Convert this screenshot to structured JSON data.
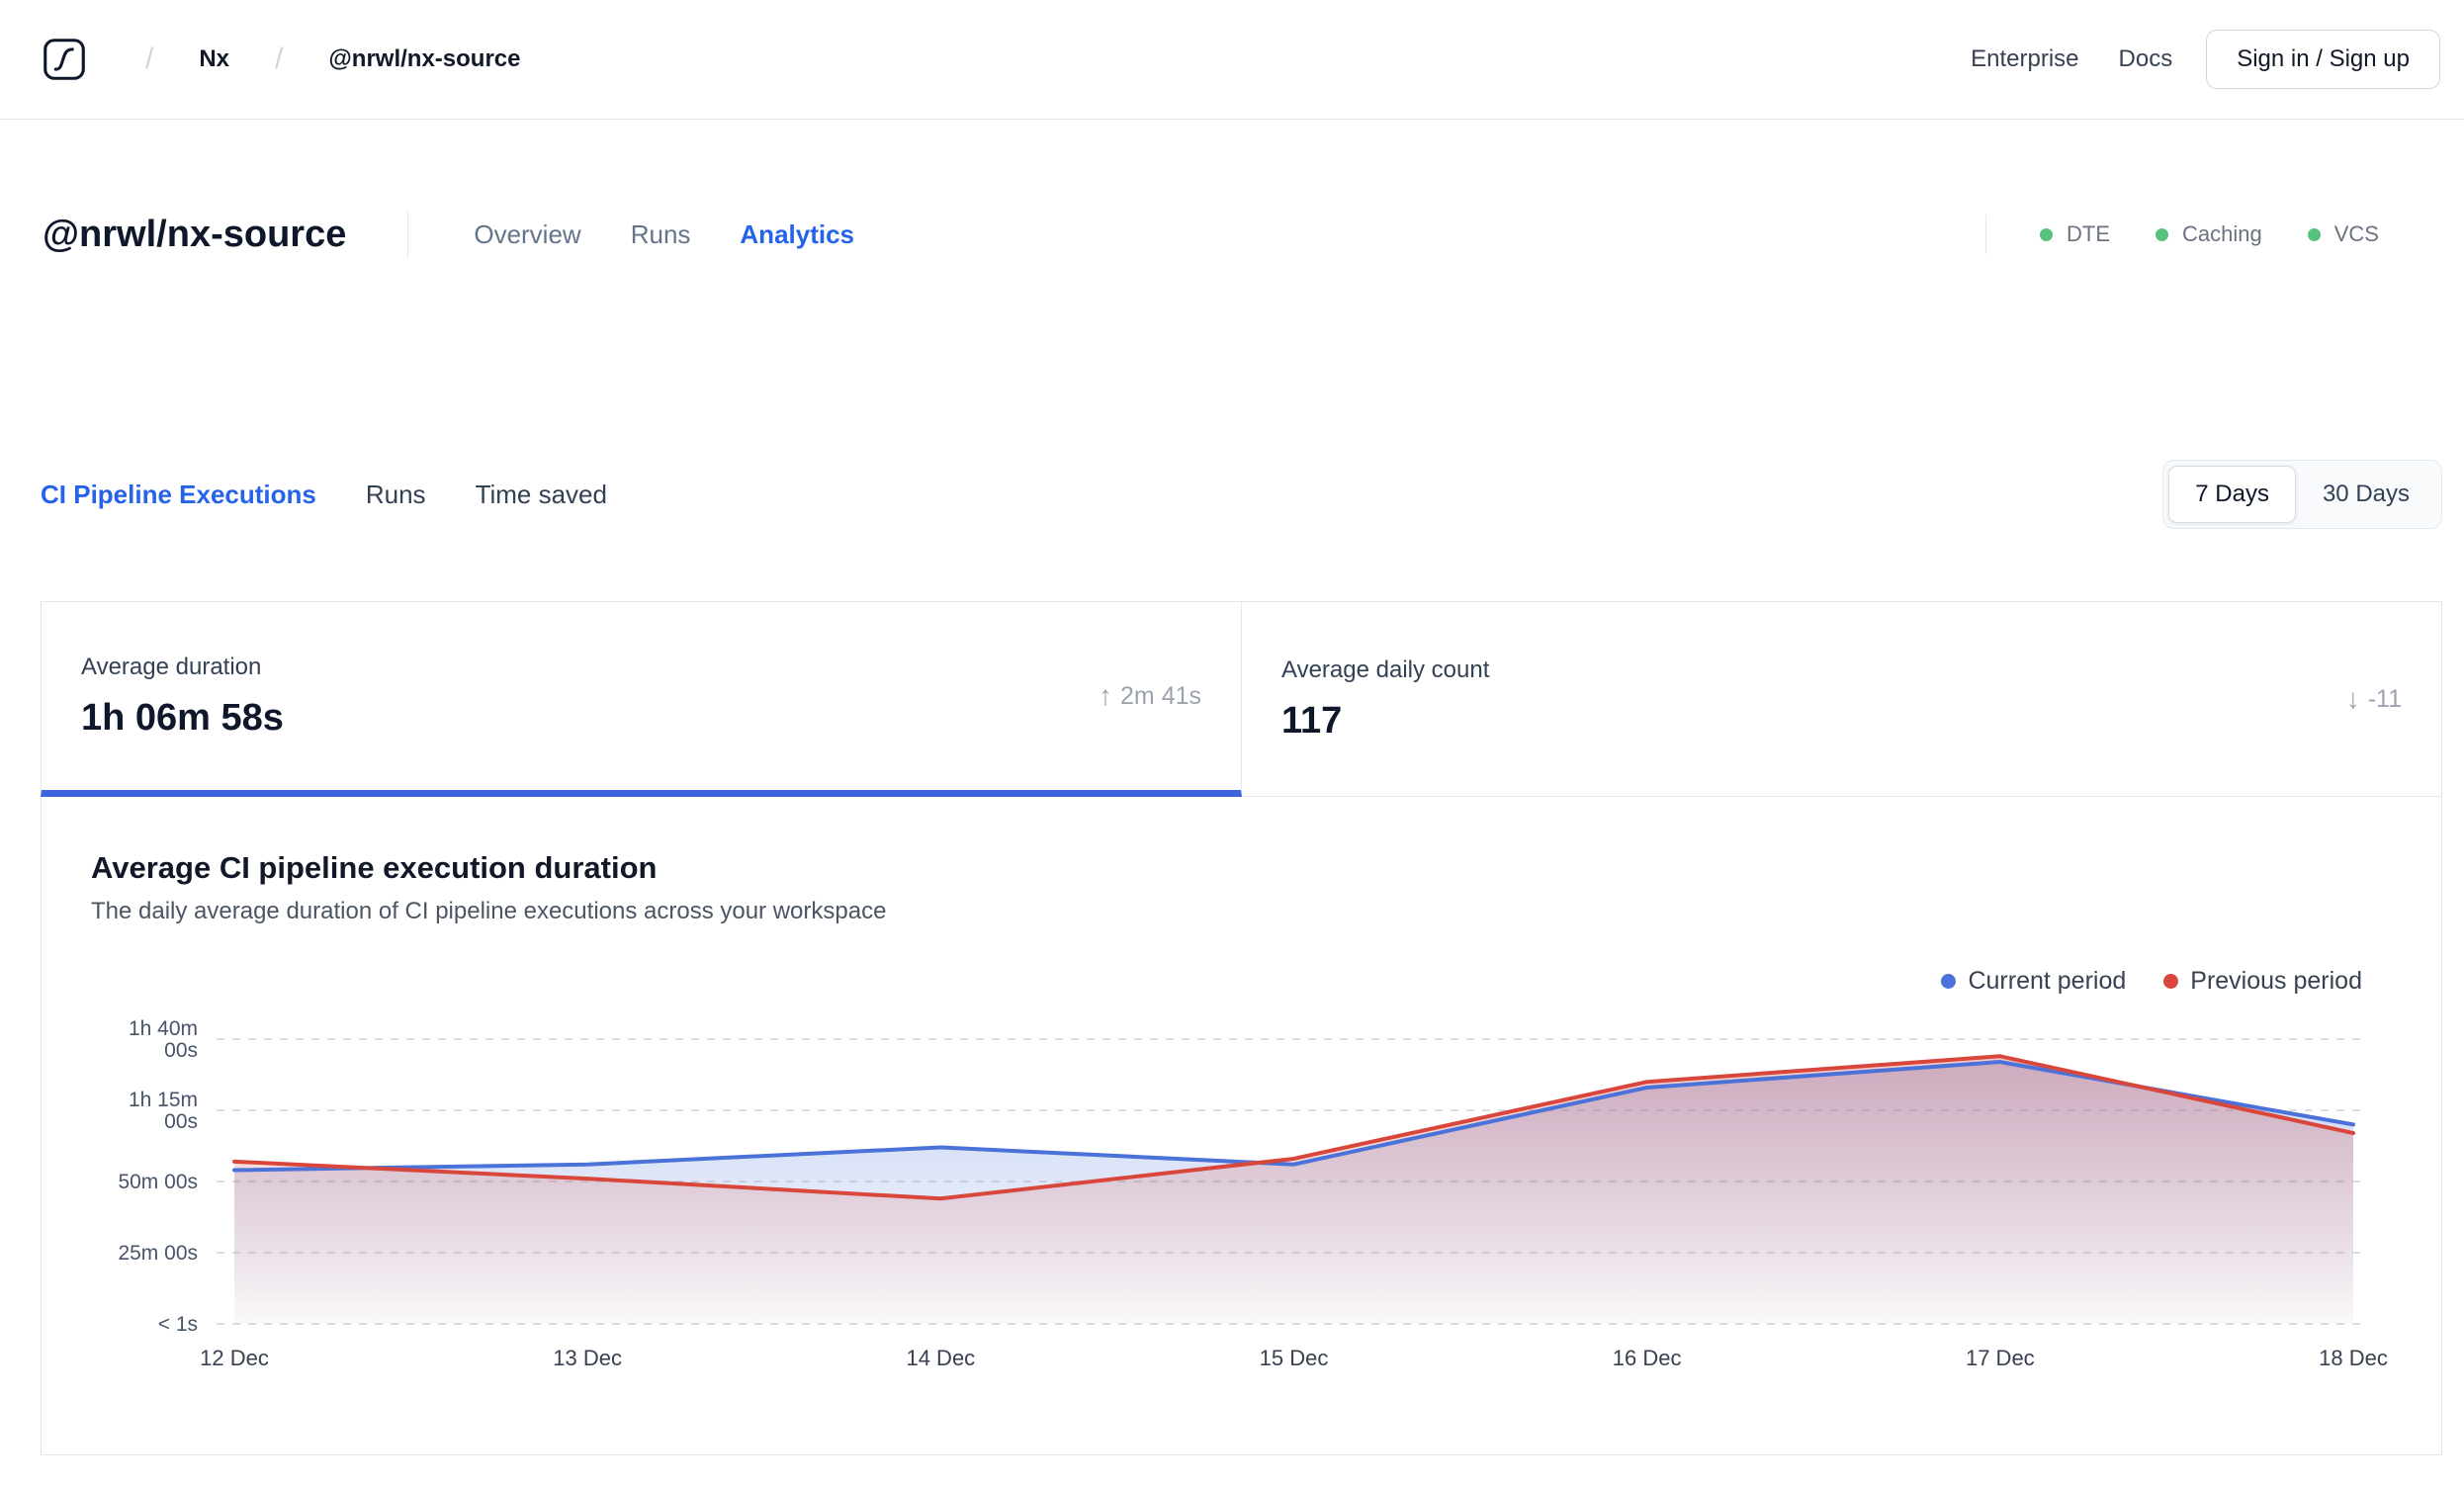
{
  "topnav": {
    "breadcrumb": {
      "separator": "/",
      "org": "Nx",
      "repo": "@nrwl/nx-source"
    },
    "links": {
      "enterprise": "Enterprise",
      "docs": "Docs"
    },
    "signin_label": "Sign in / Sign up"
  },
  "header": {
    "title": "@nrwl/nx-source",
    "tabs": [
      {
        "label": "Overview",
        "active": false
      },
      {
        "label": "Runs",
        "active": false
      },
      {
        "label": "Analytics",
        "active": true
      }
    ],
    "statuses": [
      {
        "label": "DTE",
        "color": "#57c27d"
      },
      {
        "label": "Caching",
        "color": "#57c27d"
      },
      {
        "label": "VCS",
        "color": "#57c27d"
      }
    ]
  },
  "analytics_nav": {
    "tabs": [
      {
        "label": "CI Pipeline Executions",
        "active": true
      },
      {
        "label": "Runs",
        "active": false
      },
      {
        "label": "Time saved",
        "active": false
      }
    ],
    "range_toggle": [
      {
        "label": "7 Days",
        "active": true
      },
      {
        "label": "30 Days",
        "active": false
      }
    ]
  },
  "stats": [
    {
      "label": "Average duration",
      "value": "1h 06m 58s",
      "delta": "2m 41s",
      "delta_icon": "↑",
      "active": true
    },
    {
      "label": "Average daily count",
      "value": "117",
      "delta": "-11",
      "delta_icon": "↓",
      "active": false
    }
  ],
  "chart": {
    "title": "Average CI pipeline execution duration",
    "subtitle": "The daily average duration of CI pipeline executions across your workspace",
    "legend": [
      {
        "label": "Current period",
        "color": "#4a72d8"
      },
      {
        "label": "Previous period",
        "color": "#d9473c"
      }
    ]
  },
  "chart_data": {
    "type": "line",
    "title": "Average CI pipeline execution duration",
    "x": [
      "12 Dec",
      "13 Dec",
      "14 Dec",
      "15 Dec",
      "16 Dec",
      "17 Dec",
      "18 Dec"
    ],
    "unit": "minutes",
    "ylim": [
      0,
      100
    ],
    "y_ticks": [
      {
        "value": 100,
        "label": "1h 40m\n00s"
      },
      {
        "value": 75,
        "label": "1h 15m\n00s"
      },
      {
        "value": 50,
        "label": "50m 00s"
      },
      {
        "value": 25,
        "label": "25m 00s"
      },
      {
        "value": 0,
        "label": "< 1s"
      }
    ],
    "series": [
      {
        "name": "Current period",
        "color": "#4a72d8",
        "values": [
          54,
          56,
          62,
          56,
          83,
          92,
          70
        ]
      },
      {
        "name": "Previous period",
        "color": "#d9473c",
        "values": [
          57,
          51,
          44,
          58,
          85,
          94,
          67
        ]
      }
    ],
    "grid": "dashed-horizontal",
    "legend_position": "top-right"
  }
}
